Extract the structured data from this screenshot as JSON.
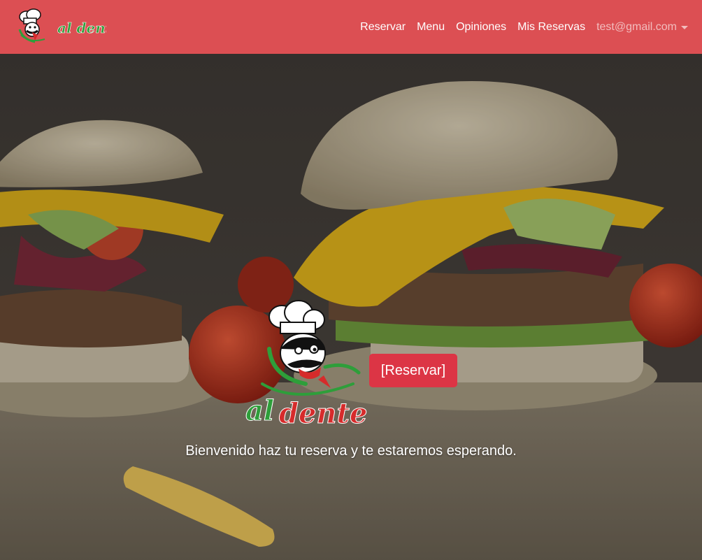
{
  "brand": {
    "name": "al dente",
    "logo_text": "al dente"
  },
  "nav": {
    "items": [
      {
        "label": "Reservar"
      },
      {
        "label": "Menu"
      },
      {
        "label": "Opiniones"
      },
      {
        "label": "Mis Reservas"
      }
    ],
    "user": "test@gmail.com"
  },
  "hero": {
    "button_label": "[Reservar]",
    "welcome": "Bienvenido haz tu reserva y te estaremos esperando."
  },
  "colors": {
    "navbar": "#dc4f53",
    "button": "#dc3545",
    "text": "#ffffff"
  }
}
